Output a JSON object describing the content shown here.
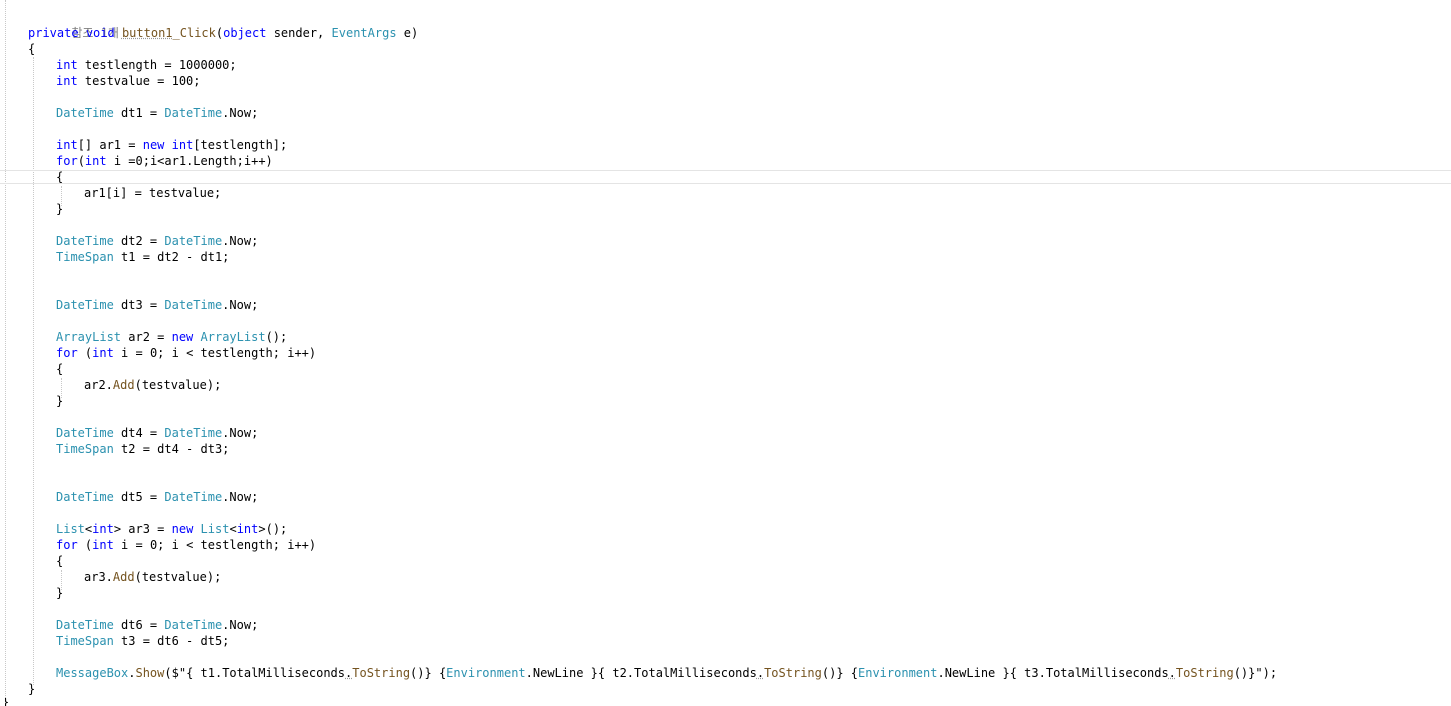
{
  "editor": {
    "reference_hint": "참조 1개",
    "lines": [
      {
        "indent": 0,
        "tokens": [
          {
            "cls": "k",
            "text": "private"
          },
          {
            "text": " "
          },
          {
            "cls": "k",
            "text": "void"
          },
          {
            "text": " "
          },
          {
            "cls": "m sq",
            "text": "button1"
          },
          {
            "cls": "m",
            "text": "_Click"
          },
          {
            "text": "("
          },
          {
            "cls": "k",
            "text": "object"
          },
          {
            "text": " sender, "
          },
          {
            "cls": "t",
            "text": "EventArgs"
          },
          {
            "text": " e)"
          }
        ]
      },
      {
        "indent": 0,
        "tokens": [
          {
            "text": "{"
          }
        ]
      },
      {
        "indent": 1,
        "tokens": [
          {
            "cls": "k",
            "text": "int"
          },
          {
            "text": " testlength = 1000000;"
          }
        ]
      },
      {
        "indent": 1,
        "tokens": [
          {
            "cls": "k",
            "text": "int"
          },
          {
            "text": " testvalue = 100;"
          }
        ]
      },
      {
        "indent": 0,
        "tokens": []
      },
      {
        "indent": 1,
        "tokens": [
          {
            "cls": "t",
            "text": "DateTime"
          },
          {
            "text": " dt1 = "
          },
          {
            "cls": "t",
            "text": "DateTime"
          },
          {
            "text": ".Now;"
          }
        ]
      },
      {
        "indent": 0,
        "tokens": []
      },
      {
        "indent": 1,
        "tokens": [
          {
            "cls": "k",
            "text": "int"
          },
          {
            "text": "[] ar1 = "
          },
          {
            "cls": "k",
            "text": "new"
          },
          {
            "text": " "
          },
          {
            "cls": "k",
            "text": "int"
          },
          {
            "text": "[testlength];"
          }
        ]
      },
      {
        "indent": 1,
        "tokens": [
          {
            "cls": "k",
            "text": "for"
          },
          {
            "text": "("
          },
          {
            "cls": "k",
            "text": "int"
          },
          {
            "text": " i =0;i<ar1.Length;i++)"
          }
        ]
      },
      {
        "indent": 1,
        "tokens": [
          {
            "text": "{"
          }
        ]
      },
      {
        "indent": 2,
        "tokens": [
          {
            "text": "ar1[i] = testvalue;"
          }
        ]
      },
      {
        "indent": 1,
        "tokens": [
          {
            "text": "}"
          }
        ]
      },
      {
        "indent": 0,
        "tokens": []
      },
      {
        "indent": 1,
        "tokens": [
          {
            "cls": "t",
            "text": "DateTime"
          },
          {
            "text": " dt2 = "
          },
          {
            "cls": "t",
            "text": "DateTime"
          },
          {
            "text": ".Now;"
          }
        ]
      },
      {
        "indent": 1,
        "tokens": [
          {
            "cls": "t",
            "text": "TimeSpan"
          },
          {
            "text": " t1 = dt2 - dt1;"
          }
        ]
      },
      {
        "indent": 0,
        "tokens": []
      },
      {
        "indent": 0,
        "tokens": []
      },
      {
        "indent": 1,
        "tokens": [
          {
            "cls": "t",
            "text": "DateTime"
          },
          {
            "text": " dt3 = "
          },
          {
            "cls": "t",
            "text": "DateTime"
          },
          {
            "text": ".Now;"
          }
        ]
      },
      {
        "indent": 0,
        "tokens": []
      },
      {
        "indent": 1,
        "tokens": [
          {
            "cls": "t",
            "text": "ArrayList"
          },
          {
            "text": " ar2 = "
          },
          {
            "cls": "k",
            "text": "new"
          },
          {
            "text": " "
          },
          {
            "cls": "t",
            "text": "ArrayList"
          },
          {
            "text": "();"
          }
        ]
      },
      {
        "indent": 1,
        "tokens": [
          {
            "cls": "k",
            "text": "for"
          },
          {
            "text": " ("
          },
          {
            "cls": "k",
            "text": "int"
          },
          {
            "text": " i = 0; i < testlength; i++)"
          }
        ]
      },
      {
        "indent": 1,
        "tokens": [
          {
            "text": "{"
          }
        ]
      },
      {
        "indent": 2,
        "tokens": [
          {
            "text": "ar2."
          },
          {
            "cls": "m",
            "text": "Add"
          },
          {
            "text": "(testvalue);"
          }
        ]
      },
      {
        "indent": 1,
        "tokens": [
          {
            "text": "}"
          }
        ]
      },
      {
        "indent": 0,
        "tokens": []
      },
      {
        "indent": 1,
        "tokens": [
          {
            "cls": "t",
            "text": "DateTime"
          },
          {
            "text": " dt4 = "
          },
          {
            "cls": "t",
            "text": "DateTime"
          },
          {
            "text": ".Now;"
          }
        ]
      },
      {
        "indent": 1,
        "tokens": [
          {
            "cls": "t",
            "text": "TimeSpan"
          },
          {
            "text": " t2 = dt4 - dt3;"
          }
        ]
      },
      {
        "indent": 0,
        "tokens": []
      },
      {
        "indent": 0,
        "tokens": []
      },
      {
        "indent": 1,
        "tokens": [
          {
            "cls": "t",
            "text": "DateTime"
          },
          {
            "text": " dt5 = "
          },
          {
            "cls": "t",
            "text": "DateTime"
          },
          {
            "text": ".Now;"
          }
        ]
      },
      {
        "indent": 0,
        "tokens": []
      },
      {
        "indent": 1,
        "tokens": [
          {
            "cls": "t",
            "text": "List"
          },
          {
            "text": "<"
          },
          {
            "cls": "k",
            "text": "int"
          },
          {
            "text": "> ar3 = "
          },
          {
            "cls": "k",
            "text": "new"
          },
          {
            "text": " "
          },
          {
            "cls": "t",
            "text": "List"
          },
          {
            "text": "<"
          },
          {
            "cls": "k",
            "text": "int"
          },
          {
            "text": ">();"
          }
        ]
      },
      {
        "indent": 1,
        "tokens": [
          {
            "cls": "k",
            "text": "for"
          },
          {
            "text": " ("
          },
          {
            "cls": "k",
            "text": "int"
          },
          {
            "text": " i = 0; i < testlength; i++)"
          }
        ]
      },
      {
        "indent": 1,
        "tokens": [
          {
            "text": "{"
          }
        ]
      },
      {
        "indent": 2,
        "tokens": [
          {
            "text": "ar3."
          },
          {
            "cls": "m",
            "text": "Add"
          },
          {
            "text": "(testvalue);"
          }
        ]
      },
      {
        "indent": 1,
        "tokens": [
          {
            "text": "}"
          }
        ]
      },
      {
        "indent": 0,
        "tokens": []
      },
      {
        "indent": 1,
        "tokens": [
          {
            "cls": "t",
            "text": "DateTime"
          },
          {
            "text": " dt6 = "
          },
          {
            "cls": "t",
            "text": "DateTime"
          },
          {
            "text": ".Now;"
          }
        ]
      },
      {
        "indent": 1,
        "tokens": [
          {
            "cls": "t",
            "text": "TimeSpan"
          },
          {
            "text": " t3 = dt6 - dt5;"
          }
        ]
      },
      {
        "indent": 0,
        "tokens": []
      },
      {
        "indent": 1,
        "tokens": [
          {
            "cls": "t",
            "text": "MessageBox"
          },
          {
            "text": "."
          },
          {
            "cls": "m",
            "text": "Show"
          },
          {
            "text": "($\"{ t1.TotalMilliseconds"
          },
          {
            "cls": "sq",
            "text": "."
          },
          {
            "cls": "m",
            "text": "ToString"
          },
          {
            "text": "()} {"
          },
          {
            "cls": "t",
            "text": "Environment"
          },
          {
            "text": ".NewLine }{ t2.TotalMilliseconds"
          },
          {
            "cls": "sq",
            "text": "."
          },
          {
            "cls": "m",
            "text": "ToString"
          },
          {
            "text": "()} {"
          },
          {
            "cls": "t",
            "text": "Environment"
          },
          {
            "text": ".NewLine }{ t3.TotalMilliseconds"
          },
          {
            "cls": "sq",
            "text": "."
          },
          {
            "cls": "m",
            "text": "ToString"
          },
          {
            "text": "()}\");"
          }
        ]
      },
      {
        "indent": 0,
        "tokens": [
          {
            "text": "}"
          }
        ]
      }
    ],
    "trailing_brace": "}"
  }
}
